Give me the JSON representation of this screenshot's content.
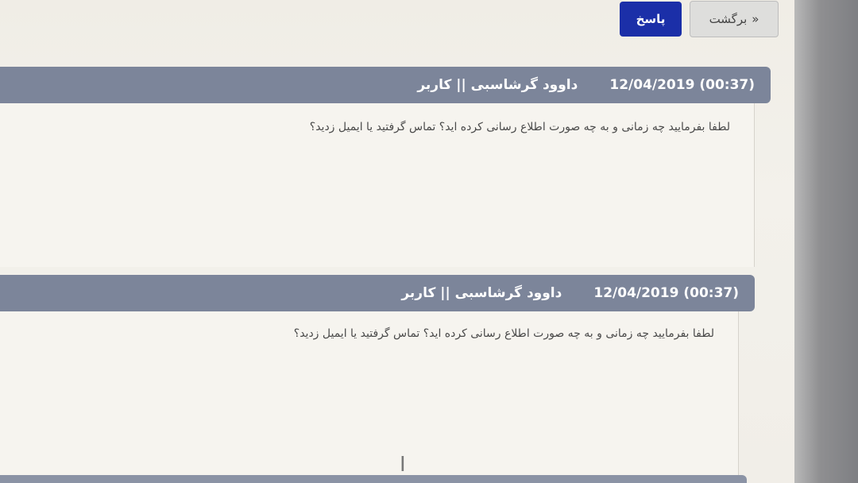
{
  "toolbar": {
    "back_label": "برگشت",
    "back_icon": "«",
    "reply_label": "پاسخ"
  },
  "messages": [
    {
      "date": "12/04/2019 (00:37)",
      "author": "داوود گرشاسبی || کاربر",
      "text": "لطفا بفرمایید چه زمانی و به چه صورت اطلاع رسانی کرده اید؟ تماس گرفتید یا ایمیل زدید؟"
    },
    {
      "date": "12/04/2019 (00:37)",
      "author": "داوود گرشاسبی || کاربر",
      "text": "لطفا بفرمایید چه زمانی و به چه صورت اطلاع رسانی کرده اید؟ تماس گرفتید یا ایمیل زدید؟"
    }
  ],
  "colors": {
    "header_bg": "#7c859a",
    "reply_bg": "#1b2fa8"
  }
}
